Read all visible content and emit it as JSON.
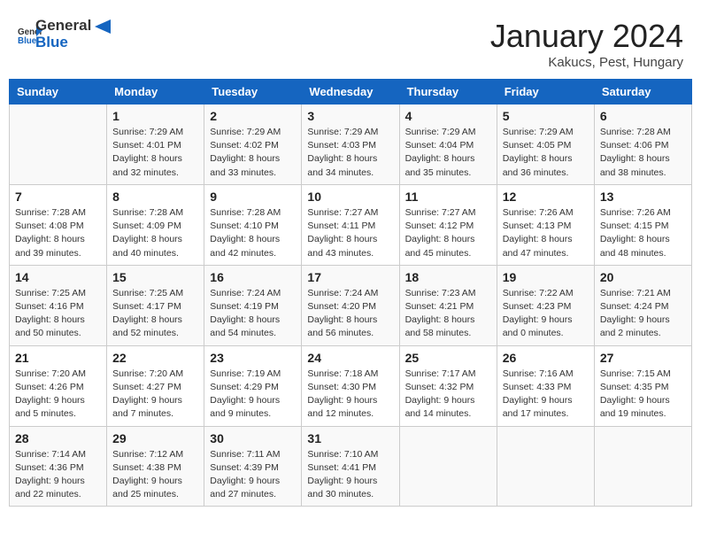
{
  "header": {
    "logo_general": "General",
    "logo_blue": "Blue",
    "title": "January 2024",
    "location": "Kakucs, Pest, Hungary"
  },
  "calendar": {
    "days_of_week": [
      "Sunday",
      "Monday",
      "Tuesday",
      "Wednesday",
      "Thursday",
      "Friday",
      "Saturday"
    ],
    "weeks": [
      [
        {
          "day": "",
          "info": ""
        },
        {
          "day": "1",
          "info": "Sunrise: 7:29 AM\nSunset: 4:01 PM\nDaylight: 8 hours\nand 32 minutes."
        },
        {
          "day": "2",
          "info": "Sunrise: 7:29 AM\nSunset: 4:02 PM\nDaylight: 8 hours\nand 33 minutes."
        },
        {
          "day": "3",
          "info": "Sunrise: 7:29 AM\nSunset: 4:03 PM\nDaylight: 8 hours\nand 34 minutes."
        },
        {
          "day": "4",
          "info": "Sunrise: 7:29 AM\nSunset: 4:04 PM\nDaylight: 8 hours\nand 35 minutes."
        },
        {
          "day": "5",
          "info": "Sunrise: 7:29 AM\nSunset: 4:05 PM\nDaylight: 8 hours\nand 36 minutes."
        },
        {
          "day": "6",
          "info": "Sunrise: 7:28 AM\nSunset: 4:06 PM\nDaylight: 8 hours\nand 38 minutes."
        }
      ],
      [
        {
          "day": "7",
          "info": "Sunrise: 7:28 AM\nSunset: 4:08 PM\nDaylight: 8 hours\nand 39 minutes."
        },
        {
          "day": "8",
          "info": "Sunrise: 7:28 AM\nSunset: 4:09 PM\nDaylight: 8 hours\nand 40 minutes."
        },
        {
          "day": "9",
          "info": "Sunrise: 7:28 AM\nSunset: 4:10 PM\nDaylight: 8 hours\nand 42 minutes."
        },
        {
          "day": "10",
          "info": "Sunrise: 7:27 AM\nSunset: 4:11 PM\nDaylight: 8 hours\nand 43 minutes."
        },
        {
          "day": "11",
          "info": "Sunrise: 7:27 AM\nSunset: 4:12 PM\nDaylight: 8 hours\nand 45 minutes."
        },
        {
          "day": "12",
          "info": "Sunrise: 7:26 AM\nSunset: 4:13 PM\nDaylight: 8 hours\nand 47 minutes."
        },
        {
          "day": "13",
          "info": "Sunrise: 7:26 AM\nSunset: 4:15 PM\nDaylight: 8 hours\nand 48 minutes."
        }
      ],
      [
        {
          "day": "14",
          "info": "Sunrise: 7:25 AM\nSunset: 4:16 PM\nDaylight: 8 hours\nand 50 minutes."
        },
        {
          "day": "15",
          "info": "Sunrise: 7:25 AM\nSunset: 4:17 PM\nDaylight: 8 hours\nand 52 minutes."
        },
        {
          "day": "16",
          "info": "Sunrise: 7:24 AM\nSunset: 4:19 PM\nDaylight: 8 hours\nand 54 minutes."
        },
        {
          "day": "17",
          "info": "Sunrise: 7:24 AM\nSunset: 4:20 PM\nDaylight: 8 hours\nand 56 minutes."
        },
        {
          "day": "18",
          "info": "Sunrise: 7:23 AM\nSunset: 4:21 PM\nDaylight: 8 hours\nand 58 minutes."
        },
        {
          "day": "19",
          "info": "Sunrise: 7:22 AM\nSunset: 4:23 PM\nDaylight: 9 hours\nand 0 minutes."
        },
        {
          "day": "20",
          "info": "Sunrise: 7:21 AM\nSunset: 4:24 PM\nDaylight: 9 hours\nand 2 minutes."
        }
      ],
      [
        {
          "day": "21",
          "info": "Sunrise: 7:20 AM\nSunset: 4:26 PM\nDaylight: 9 hours\nand 5 minutes."
        },
        {
          "day": "22",
          "info": "Sunrise: 7:20 AM\nSunset: 4:27 PM\nDaylight: 9 hours\nand 7 minutes."
        },
        {
          "day": "23",
          "info": "Sunrise: 7:19 AM\nSunset: 4:29 PM\nDaylight: 9 hours\nand 9 minutes."
        },
        {
          "day": "24",
          "info": "Sunrise: 7:18 AM\nSunset: 4:30 PM\nDaylight: 9 hours\nand 12 minutes."
        },
        {
          "day": "25",
          "info": "Sunrise: 7:17 AM\nSunset: 4:32 PM\nDaylight: 9 hours\nand 14 minutes."
        },
        {
          "day": "26",
          "info": "Sunrise: 7:16 AM\nSunset: 4:33 PM\nDaylight: 9 hours\nand 17 minutes."
        },
        {
          "day": "27",
          "info": "Sunrise: 7:15 AM\nSunset: 4:35 PM\nDaylight: 9 hours\nand 19 minutes."
        }
      ],
      [
        {
          "day": "28",
          "info": "Sunrise: 7:14 AM\nSunset: 4:36 PM\nDaylight: 9 hours\nand 22 minutes."
        },
        {
          "day": "29",
          "info": "Sunrise: 7:12 AM\nSunset: 4:38 PM\nDaylight: 9 hours\nand 25 minutes."
        },
        {
          "day": "30",
          "info": "Sunrise: 7:11 AM\nSunset: 4:39 PM\nDaylight: 9 hours\nand 27 minutes."
        },
        {
          "day": "31",
          "info": "Sunrise: 7:10 AM\nSunset: 4:41 PM\nDaylight: 9 hours\nand 30 minutes."
        },
        {
          "day": "",
          "info": ""
        },
        {
          "day": "",
          "info": ""
        },
        {
          "day": "",
          "info": ""
        }
      ]
    ]
  }
}
